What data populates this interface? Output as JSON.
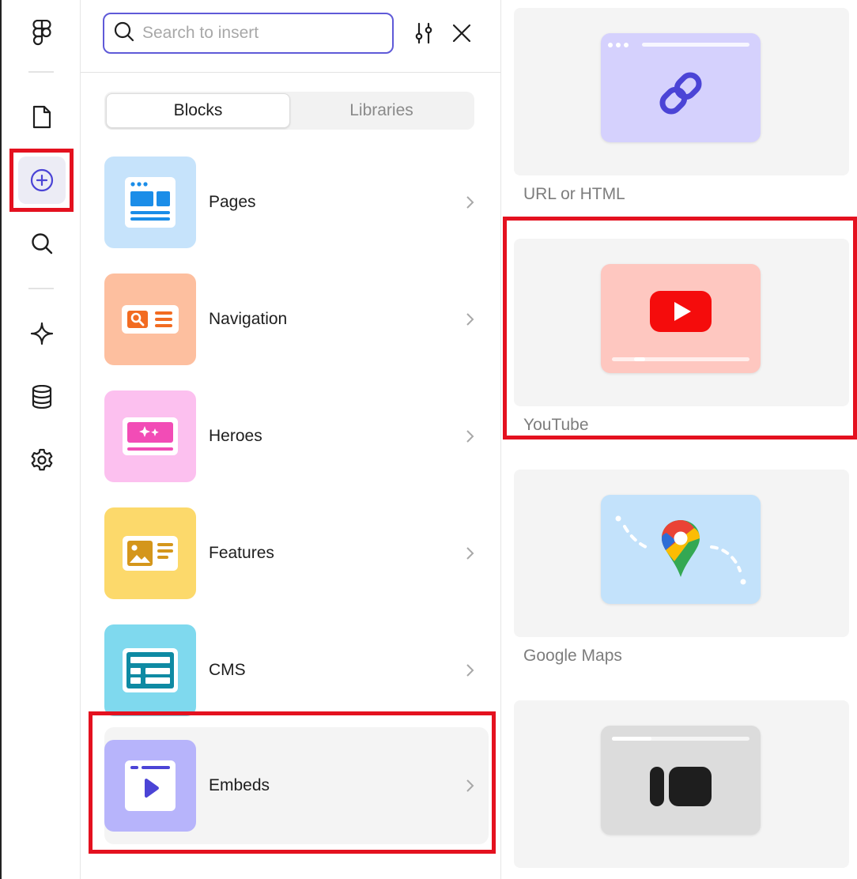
{
  "rail": {
    "items": [
      {
        "name": "figma-logo-icon",
        "active": false
      },
      {
        "name": "page-icon",
        "active": false
      },
      {
        "name": "insert-plus-icon",
        "active": true
      },
      {
        "name": "search-icon",
        "active": false
      },
      {
        "name": "ai-sparkle-icon",
        "active": false
      },
      {
        "name": "database-icon",
        "active": false
      },
      {
        "name": "settings-gear-icon",
        "active": false
      }
    ]
  },
  "search": {
    "placeholder": "Search to insert",
    "value": ""
  },
  "tabs": [
    {
      "label": "Blocks",
      "selected": true
    },
    {
      "label": "Libraries",
      "selected": false
    }
  ],
  "categories": [
    {
      "label": "Pages",
      "color": "#c6e3fb"
    },
    {
      "label": "Navigation",
      "color": "#fdbf9f"
    },
    {
      "label": "Heroes",
      "color": "#fcc0ef"
    },
    {
      "label": "Features",
      "color": "#fcd96b"
    },
    {
      "label": "CMS",
      "color": "#7fd9ee"
    },
    {
      "label": "Embeds",
      "color": "#b7b4fb"
    }
  ],
  "embeds": [
    {
      "label": "URL or HTML",
      "color": "#d5d1fd"
    },
    {
      "label": "YouTube",
      "color": "#fec7c0"
    },
    {
      "label": "Google Maps",
      "color": "#c3e2fb"
    },
    {
      "label": "",
      "color": "#dcdcdc"
    }
  ],
  "accent_color": "#5f5ad8",
  "highlight_color": "#e4111f"
}
